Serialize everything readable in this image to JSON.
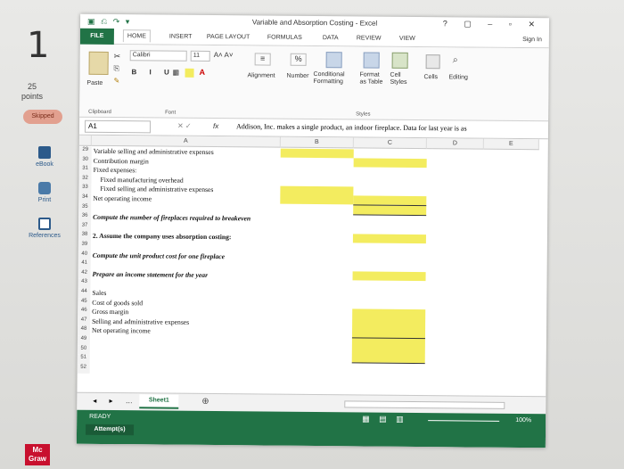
{
  "sidebar": {
    "question_number": "1",
    "points_value": "25",
    "points_label": "points",
    "skipped": "Skipped",
    "ebook": "eBook",
    "print": "Print",
    "references": "References",
    "brand": "Mc Graw"
  },
  "excel": {
    "title": "Variable and Absorption Costing - Excel",
    "tabs": [
      "FILE",
      "HOME",
      "INSERT",
      "PAGE LAYOUT",
      "FORMULAS",
      "DATA",
      "REVIEW",
      "VIEW"
    ],
    "sign_in": "Sign In",
    "ribbon": {
      "paste": "Paste",
      "clipboard": "Clipboard",
      "font_name": "Calibri",
      "font_size": "11",
      "font_label": "Font",
      "alignment": "Alignment",
      "number": "Number",
      "conditional_formatting": "Conditional Formatting",
      "format_as_table": "Format as Table",
      "cell_styles": "Cell Styles",
      "styles_label": "Styles",
      "cells": "Cells",
      "editing": "Editing"
    },
    "name_box": "A1",
    "fx": "fx",
    "formula_value": "Addison, Inc. makes a single product, an indoor fireplace. Data for last year is as",
    "columns": [
      "A",
      "B",
      "C",
      "D",
      "E"
    ],
    "rows": [
      {
        "num": "29",
        "text": "Variable selling and administrative expenses",
        "style": ""
      },
      {
        "num": "30",
        "text": "Contribution margin",
        "style": ""
      },
      {
        "num": "31",
        "text": "Fixed expenses:",
        "style": ""
      },
      {
        "num": "32",
        "text": "Fixed manufacturing overhead",
        "style": "indent"
      },
      {
        "num": "33",
        "text": "Fixed selling and administrative expenses",
        "style": "indent"
      },
      {
        "num": "34",
        "text": "Net operating income",
        "style": ""
      },
      {
        "num": "35",
        "text": "",
        "style": ""
      },
      {
        "num": "36",
        "text": "Compute the number of fireplaces required to breakeven",
        "style": "bi"
      },
      {
        "num": "37",
        "text": "",
        "style": ""
      },
      {
        "num": "38",
        "text": "2. Assume the company uses absorption costing:",
        "style": "b"
      },
      {
        "num": "39",
        "text": "",
        "style": ""
      },
      {
        "num": "40",
        "text": "Compute the unit product cost for one fireplace",
        "style": "bi"
      },
      {
        "num": "41",
        "text": "",
        "style": ""
      },
      {
        "num": "42",
        "text": "Prepare an income statement for the year",
        "style": "bi"
      },
      {
        "num": "43",
        "text": "",
        "style": ""
      },
      {
        "num": "44",
        "text": "Sales",
        "style": ""
      },
      {
        "num": "45",
        "text": "Cost of goods sold",
        "style": ""
      },
      {
        "num": "46",
        "text": "Gross margin",
        "style": ""
      },
      {
        "num": "47",
        "text": "Selling and administrative expenses",
        "style": ""
      },
      {
        "num": "48",
        "text": "Net operating income",
        "style": ""
      },
      {
        "num": "49",
        "text": "",
        "style": ""
      },
      {
        "num": "50",
        "text": "",
        "style": ""
      },
      {
        "num": "51",
        "text": "",
        "style": ""
      },
      {
        "num": "52",
        "text": "",
        "style": ""
      }
    ],
    "sheet_tab": "Sheet1",
    "status_ready": "READY",
    "attempts": "Attempt(s)",
    "zoom": "100%",
    "colors": {
      "excel_green": "#217346",
      "input_yellow": "#f3ec5f"
    }
  }
}
